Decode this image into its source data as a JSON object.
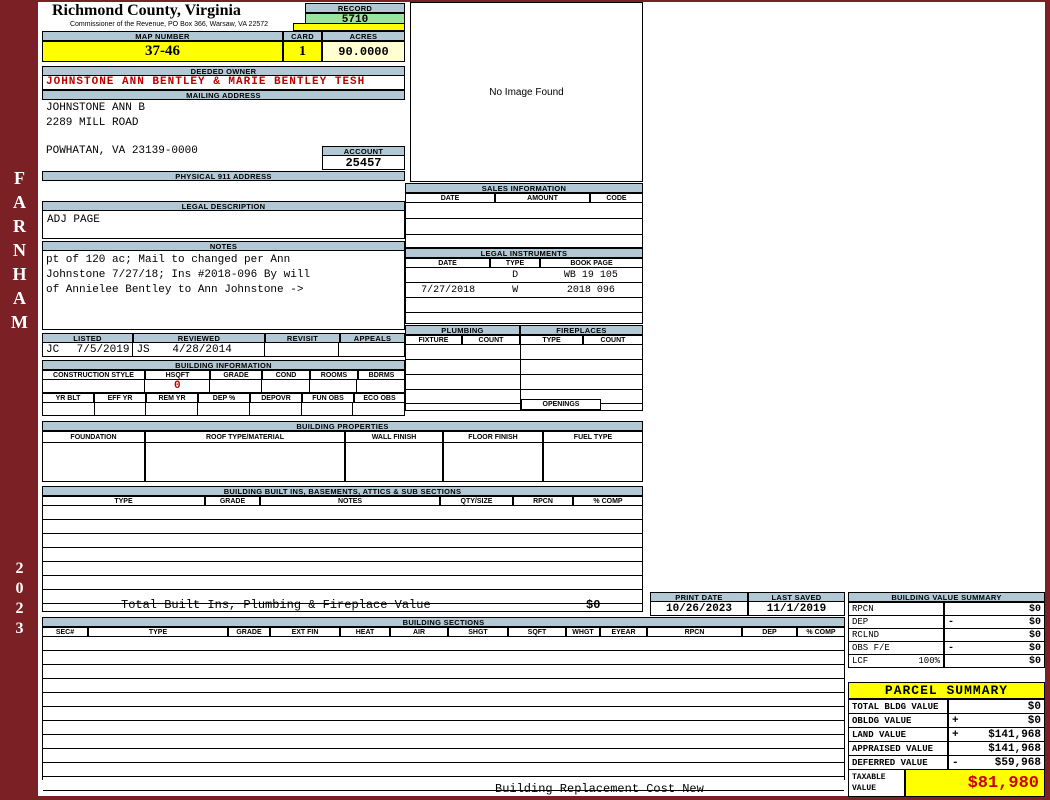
{
  "colors": {
    "sidebar": "#7b2125",
    "header_bar": "#b2c8d4",
    "highlight_yellow": "#ffff00",
    "record_green": "#9be49b",
    "pale_yellow": "#ffffd2",
    "alert_red": "#c00000"
  },
  "sidebar": {
    "district": "FARNHAM",
    "year": "2023"
  },
  "county": {
    "title": "Richmond County, Virginia",
    "subtitle": "Commissioner of the Revenue, PO Box 366, Warsaw, VA 22572"
  },
  "record": {
    "label": "RECORD",
    "value": "5710"
  },
  "map_number": {
    "label": "MAP NUMBER",
    "value": "37-46"
  },
  "card": {
    "label": "CARD",
    "value": "1"
  },
  "acres": {
    "label": "ACRES",
    "value": "90.0000"
  },
  "owner": {
    "label": "DEEDED OWNER",
    "name": "JOHNSTONE ANN BENTLEY & MARIE BENTLEY TESH"
  },
  "mailing": {
    "label": "MAILING ADDRESS",
    "line1": "JOHNSTONE ANN B",
    "line2": "2289 MILL ROAD",
    "line3": "POWHATAN, VA 23139-0000"
  },
  "account": {
    "label": "ACCOUNT",
    "value": "25457"
  },
  "physical_address": {
    "label": "PHYSICAL 911 ADDRESS"
  },
  "image_panel": {
    "text": "No Image Found"
  },
  "legal_description": {
    "label": "LEGAL DESCRIPTION",
    "value": "ADJ PAGE"
  },
  "notes": {
    "label": "NOTES",
    "line1": "pt of 120 ac; Mail to changed per Ann",
    "line2": "Johnstone 7/27/18; Ins #2018-096 By will",
    "line3": "of Annielee Bentley to Ann Johnstone ->"
  },
  "sales": {
    "label": "SALES INFORMATION",
    "columns": [
      "DATE",
      "AMOUNT",
      "CODE"
    ]
  },
  "instruments": {
    "label": "LEGAL INSTRUMENTS",
    "columns": [
      "DATE",
      "TYPE",
      "BOOK PAGE"
    ],
    "rows": [
      {
        "date": "",
        "type": "D",
        "book": "WB 19 105"
      },
      {
        "date": "7/27/2018",
        "type": "W",
        "book": "2018 096"
      }
    ]
  },
  "plumbing": {
    "label": "PLUMBING",
    "columns": [
      "FIXTURE",
      "COUNT"
    ]
  },
  "fireplaces": {
    "label": "FIREPLACES",
    "columns": [
      "TYPE",
      "COUNT"
    ],
    "openings": "OPENINGS"
  },
  "review": {
    "listed_label": "LISTED",
    "listed_by": "JC",
    "listed_date": "7/5/2019",
    "reviewed_label": "REVIEWED",
    "reviewed_by": "JS",
    "reviewed_date": "4/28/2014",
    "revisit_label": "REVISIT",
    "appeals_label": "APPEALS"
  },
  "building_info": {
    "label": "BUILDING INFORMATION",
    "columns_row1": [
      "CONSTRUCTION STYLE",
      "HSQFT",
      "GRADE",
      "COND",
      "ROOMS",
      "BDRMS"
    ],
    "hsqft_value": "0",
    "columns_row2": [
      "YR BLT",
      "EFF YR",
      "REM YR",
      "DEP %",
      "DEPOVR",
      "FUN OBS",
      "ECO OBS"
    ]
  },
  "building_properties": {
    "label": "BUILDING PROPERTIES",
    "columns": [
      "FOUNDATION",
      "ROOF TYPE/MATERIAL",
      "WALL FINISH",
      "FLOOR FINISH",
      "FUEL TYPE"
    ]
  },
  "built_ins": {
    "label": "BUILDING BUILT INS, BASEMENTS, ATTICS & SUB SECTIONS",
    "columns": [
      "TYPE",
      "GRADE",
      "NOTES",
      "QTY/SIZE",
      "RPCN",
      "% COMP"
    ],
    "total_label": "Total Built Ins, Plumbing & Fireplace Value",
    "total_value": "$0"
  },
  "print_info": {
    "print_date_label": "PRINT DATE",
    "print_date": "10/26/2023",
    "last_saved_label": "LAST SAVED",
    "last_saved": "11/1/2019"
  },
  "building_value_summary": {
    "label": "BUILDING VALUE SUMMARY",
    "rows": [
      {
        "name": "RPCN",
        "pre": "",
        "op": "",
        "value": "$0"
      },
      {
        "name": "DEP",
        "pre": "",
        "op": "-",
        "value": "$0"
      },
      {
        "name": "RCLND",
        "pre": "",
        "op": "",
        "value": "$0"
      },
      {
        "name": "OBS F/E",
        "pre": "",
        "op": "-",
        "value": "$0"
      },
      {
        "name": "LCF",
        "pre": "100%",
        "op": "",
        "value": "$0"
      }
    ]
  },
  "building_sections": {
    "label": "BUILDING SECTIONS",
    "columns": [
      "SEC#",
      "TYPE",
      "GRADE",
      "EXT FIN",
      "HEAT",
      "AIR",
      "SHGT",
      "SQFT",
      "WHGT",
      "EYEAR",
      "RPCN",
      "DEP",
      "% COMP"
    ]
  },
  "parcel_summary": {
    "label": "PARCEL SUMMARY",
    "rows": [
      {
        "name": "TOTAL BLDG VALUE",
        "op": "",
        "value": "$0"
      },
      {
        "name": "OBLDG VALUE",
        "op": "+",
        "value": "$0"
      },
      {
        "name": "LAND VALUE",
        "op": "+",
        "value": "$141,968"
      },
      {
        "name": "APPRAISED VALUE",
        "op": "",
        "value": "$141,968"
      },
      {
        "name": "DEFERRED VALUE",
        "op": "-",
        "value": "$59,968"
      },
      {
        "name": "TAXABLE VALUE",
        "op": "",
        "value": "$81,980"
      }
    ]
  },
  "footer": {
    "text": "Building Replacement Cost New"
  }
}
